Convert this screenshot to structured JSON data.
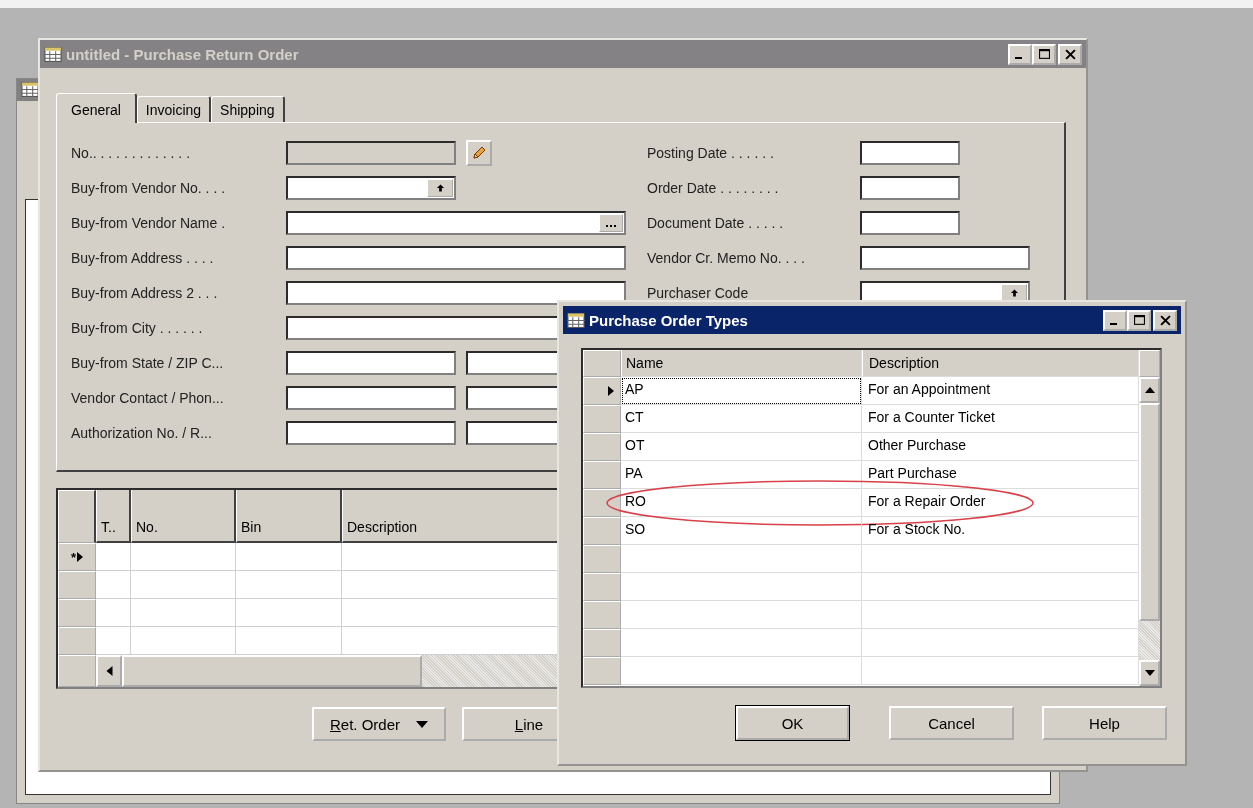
{
  "main_window": {
    "title": "untitled - Purchase Return Order",
    "tabs": [
      {
        "label": "General",
        "selected": true
      },
      {
        "label": "Invoicing",
        "selected": false
      },
      {
        "label": "Shipping",
        "selected": false
      }
    ],
    "left_fields": [
      {
        "label": "No.. . . . . . . . . . . . .",
        "kind": "numbered"
      },
      {
        "label": "Buy-from Vendor No. . . .",
        "kind": "lookup"
      },
      {
        "label": "Buy-from Vendor Name .",
        "kind": "assist"
      },
      {
        "label": "Buy-from Address . . . .",
        "kind": "text"
      },
      {
        "label": "Buy-from Address 2 . . .",
        "kind": "text"
      },
      {
        "label": "Buy-from City . . . . . .",
        "kind": "text"
      },
      {
        "label": "Buy-from State / ZIP C...",
        "kind": "pair"
      },
      {
        "label": "Vendor Contact / Phon...",
        "kind": "pair"
      },
      {
        "label": "Authorization No. / R...",
        "kind": "pair"
      }
    ],
    "right_fields": [
      {
        "label": "Posting Date . . . . . .",
        "kind": "date"
      },
      {
        "label": "Order Date . . . . . . . .",
        "kind": "date"
      },
      {
        "label": "Document Date . . . . .",
        "kind": "date"
      },
      {
        "label": "Vendor Cr. Memo No. . . .",
        "kind": "text"
      },
      {
        "label": "Purchaser Code",
        "kind": "lookup"
      }
    ],
    "lines_table": {
      "columns": [
        "T..",
        "No.",
        "Bin",
        "Description"
      ],
      "new_row_marker": "*"
    },
    "buttons": [
      {
        "label": "Ret. Order",
        "kind": "menu",
        "underline_first": true
      },
      {
        "label": "Line",
        "kind": "plain",
        "underline_first": true
      }
    ]
  },
  "dialog": {
    "title": "Purchase Order Types",
    "columns": [
      "Name",
      "Description"
    ],
    "rows": [
      {
        "name": "AP",
        "description": "For an Appointment",
        "selected": true,
        "circled": false
      },
      {
        "name": "CT",
        "description": "For a Counter Ticket",
        "selected": false,
        "circled": false
      },
      {
        "name": "OT",
        "description": "Other Purchase",
        "selected": false,
        "circled": false
      },
      {
        "name": "PA",
        "description": "Part Purchase",
        "selected": false,
        "circled": false
      },
      {
        "name": "RO",
        "description": "For a Repair Order",
        "selected": false,
        "circled": true
      },
      {
        "name": "SO",
        "description": "For a Stock No.",
        "selected": false,
        "circled": false
      }
    ],
    "buttons": [
      {
        "label": "OK",
        "default": true
      },
      {
        "label": "Cancel",
        "default": false
      },
      {
        "label": "Help",
        "default": false
      }
    ]
  }
}
